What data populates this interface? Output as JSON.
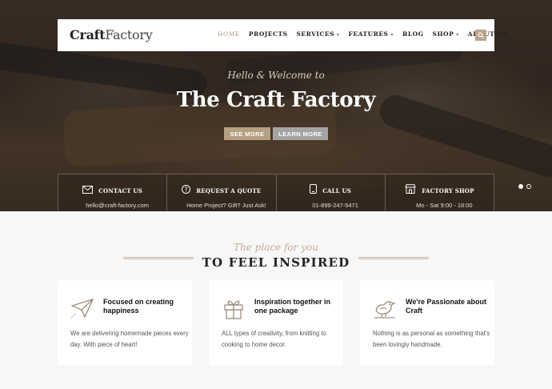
{
  "site": {
    "logo_bold": "Craft",
    "logo_light": "Factory"
  },
  "nav": {
    "items": [
      {
        "label": "HOME",
        "dropdown": false,
        "active": true
      },
      {
        "label": "PROJECTS",
        "dropdown": false,
        "active": false
      },
      {
        "label": "SERVICES",
        "dropdown": true,
        "active": false
      },
      {
        "label": "FEATURES",
        "dropdown": true,
        "active": false
      },
      {
        "label": "BLOG",
        "dropdown": false,
        "active": false
      },
      {
        "label": "SHOP",
        "dropdown": true,
        "active": false
      },
      {
        "label": "ABOUT US",
        "dropdown": false,
        "active": false
      }
    ],
    "search_icon": "search-icon"
  },
  "hero": {
    "script": "Hello & Welcome to",
    "title": "The Craft Factory",
    "btn_see_more": "SEE MORE",
    "btn_learn_more": "LEARN MORE"
  },
  "info": [
    {
      "icon": "envelope-icon",
      "title": "CONTACT US",
      "text": "hello@craft-factory.com"
    },
    {
      "icon": "question-icon",
      "title": "REQUEST A QUOTE",
      "text": "Home Project? Gift? Just Ask!"
    },
    {
      "icon": "phone-icon",
      "title": "CALL US",
      "text": "01-899-247-5471"
    },
    {
      "icon": "shop-icon",
      "title": "FACTORY SHOP",
      "text": "Mo - Sat 9:00 - 18:00"
    }
  ],
  "slider": {
    "active_dot": 1,
    "dot_count": 2
  },
  "section": {
    "script": "The place for you",
    "title": "TO FEEL INSPIRED"
  },
  "cards": [
    {
      "icon": "paper-plane-icon",
      "title": "Focused on creating happiness",
      "text": "We are delivering homemade pieces every day. With piece of heart!"
    },
    {
      "icon": "gift-icon",
      "title": "Inspiration together in one package",
      "text": "ALL types of creativity, from knitting to cooking to home decor."
    },
    {
      "icon": "bird-icon",
      "title": "We're Passionate about Craft",
      "text": "Nothing is as personal as something that's been lovingly handmade."
    }
  ],
  "colors": {
    "accent": "#b79f82",
    "button_secondary": "#a4a4a4",
    "script": "#c3ab8f"
  }
}
